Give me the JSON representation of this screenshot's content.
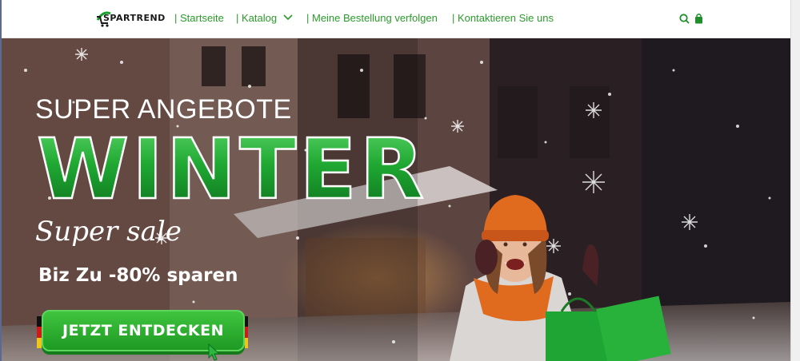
{
  "brand": {
    "logo_text": "SPARTREND",
    "accent_color": "#2b9b2b",
    "logo_icon": "shopping-cart-swoosh-icon"
  },
  "nav": {
    "items": [
      {
        "label": "| Startseite"
      },
      {
        "label": "| Katalog"
      },
      {
        "label": "| Meine Bestellung verfolgen"
      },
      {
        "label": "| Kontaktieren Sie uns"
      }
    ],
    "catalog_dropdown_icon": "chevron-down-icon"
  },
  "header_icons": {
    "search": "search-icon",
    "cart": "shopping-bag-icon"
  },
  "hero": {
    "subtitle": "SUPER ANGEBOTE",
    "title": "WINTER",
    "script": "Super sale",
    "discount": "Biz Zu -80% sparen",
    "cta_label": "JETZT ENTDECKEN",
    "title_color": "#1fa832"
  }
}
